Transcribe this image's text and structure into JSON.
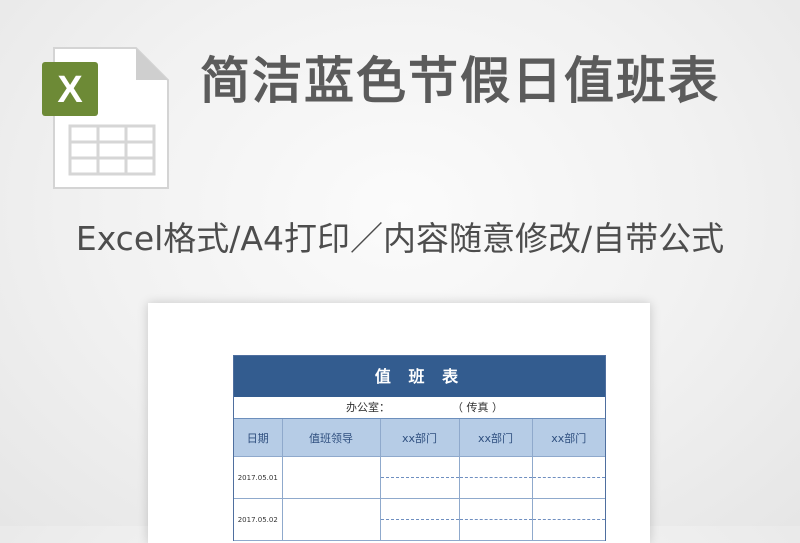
{
  "header": {
    "title": "简洁蓝色节假日值班表",
    "subtitle": "Excel格式/A4打印／内容随意修改/自带公式"
  },
  "file_icon": {
    "badge_letter": "X",
    "badge_color": "#6d8a36"
  },
  "sheet": {
    "title": "值 班 表",
    "office_label": "办公室：",
    "fax_label": "（ 传真 ）",
    "columns": [
      "日期",
      "值班领导",
      "xx部门",
      "xx部门",
      "xx部门"
    ],
    "rows": [
      {
        "date": "2017.05.01"
      },
      {
        "date": "2017.05.02"
      }
    ],
    "colors": {
      "title_bg": "#335c8f",
      "header_bg": "#b6cce6"
    }
  }
}
